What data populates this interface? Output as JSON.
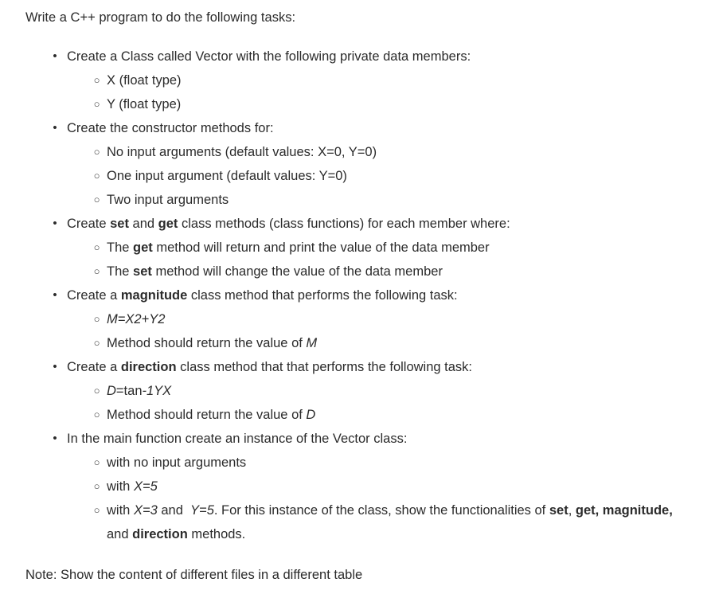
{
  "document": {
    "intro": "Write a C++ program to do the following tasks:",
    "outro": "Note: Show the content of different files in a different table",
    "bullet_glyphs": {
      "level1": "•",
      "level2": "○"
    },
    "text_color": "#2b2b2b",
    "background_color": "#ffffff",
    "items": [
      {
        "text": "Create a Class called Vector with the following private data members:",
        "html": "Create a Class called Vector with the following private data members:",
        "children": [
          {
            "text": "X (float type)",
            "html": "X (float type)"
          },
          {
            "text": "Y (float type)",
            "html": "Y (float type)"
          }
        ]
      },
      {
        "text": "Create the constructor methods for:",
        "html": "Create the constructor methods for:",
        "children": [
          {
            "text": "No input arguments (default values: X=0, Y=0)",
            "html": "No input arguments (default values: X=0, Y=0)"
          },
          {
            "text": "One input argument (default values: Y=0)",
            "html": "One input argument (default values: Y=0)"
          },
          {
            "text": "Two input arguments",
            "html": "Two input arguments"
          }
        ]
      },
      {
        "text": "Create set and get class methods (class functions) for each member where:",
        "html": "Create <b>set</b> and <b>get</b> class methods (class functions) for each member where:",
        "children": [
          {
            "text": "The get method will return and print the value of the data member",
            "html": "The <b>get</b> method will return and print the value of the data member"
          },
          {
            "text": "The set method will change the value of the data member",
            "html": "The <b>set</b> method will change the value of the data member"
          }
        ]
      },
      {
        "text": "Create a magnitude class method that performs the following task:",
        "html": "Create a <b>magnitude</b> class method that performs the following task:",
        "children": [
          {
            "text": "M=X2+Y2",
            "html": "<i>M=X2+Y2</i>"
          },
          {
            "text": "Method should return the value of M",
            "html": "Method should return the value of <i>M</i>"
          }
        ]
      },
      {
        "text": "Create a direction class method that that performs the following task:",
        "html": "Create a <b>direction</b> class method that that performs the following task:",
        "children": [
          {
            "text": "D=tan-1YX",
            "html": "<i>D</i>=tan<i>-1YX</i>"
          },
          {
            "text": "Method should return the value of D",
            "html": "Method should return the value of <i>D</i>"
          }
        ]
      },
      {
        "text": "In the main function create an instance of the Vector class:",
        "html": "In the main function create an instance of the Vector class:",
        "children": [
          {
            "text": "with no input arguments",
            "html": "with no input arguments"
          },
          {
            "text": "with X=5",
            "html": "with <i>X=5</i>"
          },
          {
            "text": "with X=3 and Y=5. For this instance of the class, show the functionalities of set, get, magnitude, and direction methods.",
            "html": "with <i>X=3 </i>and <i>&nbsp;Y=5</i>. For this instance of the class, show the functionalities of <b>set</b>, <b>get, magnitude,</b> and <b>direction</b> methods.",
            "wrap": true
          }
        ]
      }
    ]
  }
}
